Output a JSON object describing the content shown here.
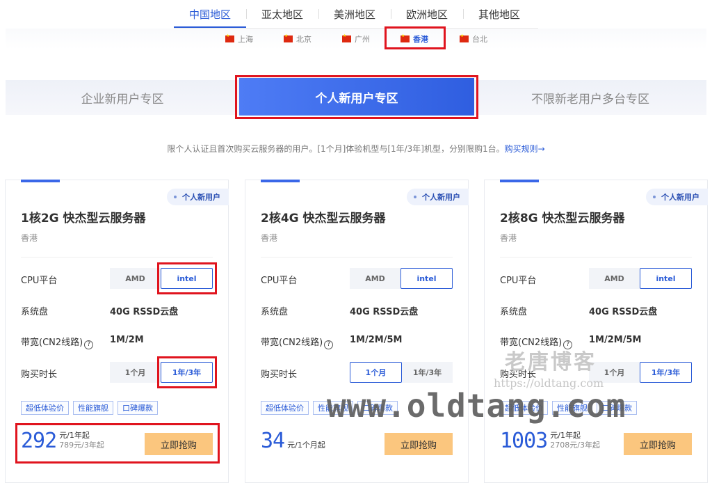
{
  "regions": [
    "中国地区",
    "亚太地区",
    "美洲地区",
    "欧洲地区",
    "其他地区"
  ],
  "cities": [
    "上海",
    "北京",
    "广州",
    "香港",
    "台北"
  ],
  "zones": [
    "企业新用户专区",
    "个人新用户专区",
    "不限新老用户多台专区"
  ],
  "notice": {
    "text": "限个人认证且首次购买云服务器的用户。[1个月]体验机型与[1年/3年]机型，分别限购1台。",
    "link": "购买规则→"
  },
  "labels": {
    "cpu": "CPU平台",
    "disk": "系统盘",
    "bandwidth": "带宽(CN2线路)",
    "duration": "购买时长",
    "amd": "AMD",
    "intel": "intel",
    "month": "1个月",
    "year": "1年/3年",
    "buy": "立即抢购",
    "badge": "个人新用户",
    "help": "?"
  },
  "cards": [
    {
      "title": "1核2G 快杰型云服务器",
      "location": "香港",
      "disk": "40G RSSD云盘",
      "bandwidth": "1M/2M",
      "tags": [
        "超低体验价",
        "性能旗舰",
        "口碑爆款"
      ],
      "price": "292",
      "unit": "元/1年起",
      "sub": "789元/3年起"
    },
    {
      "title": "2核4G 快杰型云服务器",
      "location": "香港",
      "disk": "40G RSSD云盘",
      "bandwidth": "1M/2M/5M",
      "tags": [
        "超低体验价",
        "性能旗舰",
        "口碑爆款"
      ],
      "price": "34",
      "unit": "元/1个月起",
      "sub": ""
    },
    {
      "title": "2核8G 快杰型云服务器",
      "location": "香港",
      "disk": "40G RSSD云盘",
      "bandwidth": "1M/2M/5M",
      "tags": [
        "超低体验价",
        "性能旗舰",
        "口碑爆款"
      ],
      "price": "1003",
      "unit": "元/1年起",
      "sub": "2708元/3年起"
    }
  ],
  "watermark": {
    "main": "www.oldtang.com",
    "cn": "老唐博客",
    "url": "https://oldtang.com"
  },
  "colors": {
    "accent": "#2a5bd7",
    "highlight": "#e0141e",
    "buy": "#fbc67e"
  }
}
